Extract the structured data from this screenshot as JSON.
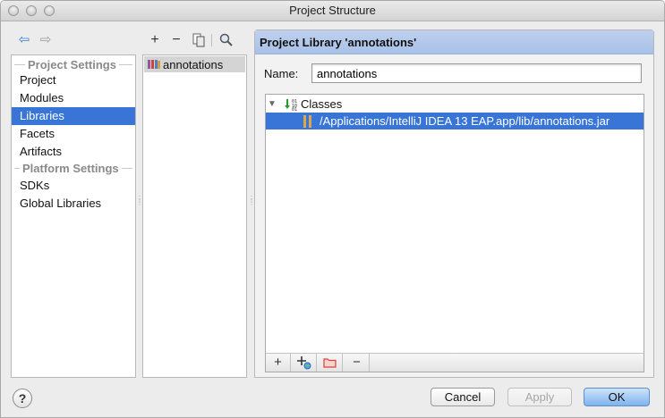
{
  "window": {
    "title": "Project Structure"
  },
  "nav": {
    "back_icon": "arrow-left-icon",
    "forward_icon": "arrow-right-icon"
  },
  "sidebar": {
    "project_settings_header": "Project Settings",
    "platform_settings_header": "Platform Settings",
    "items": [
      {
        "label": "Project"
      },
      {
        "label": "Modules"
      },
      {
        "label": "Libraries",
        "selected": true
      },
      {
        "label": "Facets"
      },
      {
        "label": "Artifacts"
      },
      {
        "label": "SDKs"
      },
      {
        "label": "Global Libraries"
      }
    ]
  },
  "library_toolbar": {
    "add": "+",
    "remove": "−"
  },
  "library_list": {
    "items": [
      {
        "label": "annotations"
      }
    ]
  },
  "detail": {
    "header": "Project Library 'annotations'",
    "name_label": "Name:",
    "name_value": "annotations",
    "tree": {
      "root_label": "Classes",
      "child_label": "/Applications/IntelliJ IDEA 13 EAP.app/lib/annotations.jar"
    },
    "tree_toolbar": {
      "add": "+",
      "remove": "−"
    }
  },
  "buttons": {
    "help": "?",
    "cancel": "Cancel",
    "apply": "Apply",
    "ok": "OK"
  },
  "colors": {
    "selection": "#3875d7",
    "header_bg": "#b6cbee",
    "primary_button": "#7eb3ee"
  }
}
